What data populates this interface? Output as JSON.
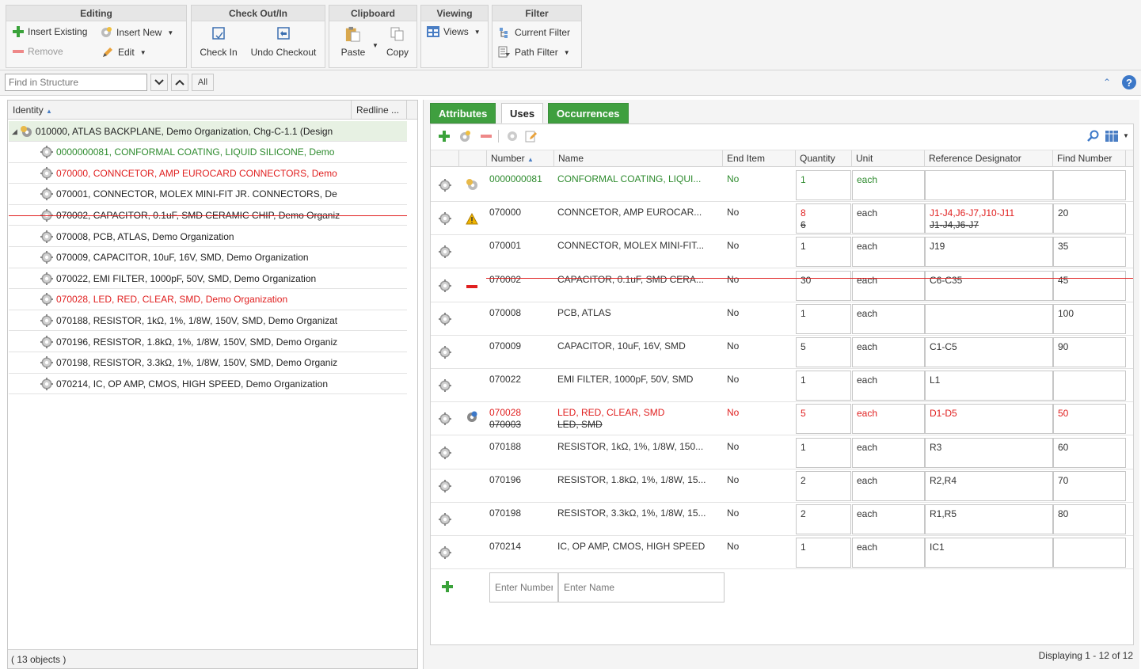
{
  "toolbar": {
    "editing": {
      "title": "Editing",
      "insert_existing": "Insert Existing",
      "insert_new": "Insert New",
      "remove": "Remove",
      "edit": "Edit"
    },
    "checkout": {
      "title": "Check Out/In",
      "check_in": "Check In",
      "undo_checkout": "Undo Checkout"
    },
    "clipboard": {
      "title": "Clipboard",
      "paste": "Paste",
      "copy": "Copy"
    },
    "viewing": {
      "title": "Viewing",
      "views": "Views"
    },
    "filter": {
      "title": "Filter",
      "current_filter": "Current Filter",
      "path_filter": "Path Filter"
    }
  },
  "find": {
    "placeholder": "Find in Structure",
    "all_label": "All"
  },
  "tree": {
    "columns": {
      "identity": "Identity",
      "redline": "Redline ..."
    },
    "rows": [
      {
        "text": "010000, ATLAS BACKPLANE, Demo Organization, Chg-C-1.1 (Design",
        "status": "normal"
      },
      {
        "text": "0000000081, CONFORMAL COATING, LIQUID SILICONE, Demo",
        "status": "added"
      },
      {
        "text": "070000, CONNCETOR,  AMP EUROCARD CONNECTORS, Demo",
        "status": "changed"
      },
      {
        "text": "070001, CONNECTOR, MOLEX MINI-FIT JR. CONNECTORS, De",
        "status": "normal"
      },
      {
        "text": "070002, CAPACITOR, 0.1uF, SMD CERAMIC CHIP, Demo Organiz",
        "status": "removed"
      },
      {
        "text": "070008, PCB, ATLAS, Demo Organization",
        "status": "normal"
      },
      {
        "text": "070009, CAPACITOR,  10uF, 16V, SMD, Demo Organization",
        "status": "normal"
      },
      {
        "text": "070022, EMI FILTER, 1000pF, 50V, SMD, Demo Organization",
        "status": "normal"
      },
      {
        "text": "070028, LED, RED, CLEAR, SMD, Demo Organization",
        "status": "changed"
      },
      {
        "text": "070188, RESISTOR, 1kΩ, 1%, 1/8W, 150V, SMD, Demo Organizat",
        "status": "normal"
      },
      {
        "text": "070196, RESISTOR, 1.8kΩ, 1%, 1/8W, 150V, SMD, Demo Organiz",
        "status": "normal"
      },
      {
        "text": "070198, RESISTOR, 3.3kΩ, 1%, 1/8W, 150V, SMD, Demo Organiz",
        "status": "normal"
      },
      {
        "text": "070214, IC, OP AMP, CMOS, HIGH SPEED, Demo Organization",
        "status": "normal"
      }
    ],
    "footer": "( 13 objects )"
  },
  "tabs": [
    {
      "label": "Attributes",
      "active": false
    },
    {
      "label": "Uses",
      "active": true
    },
    {
      "label": "Occurrences",
      "active": false
    }
  ],
  "grid": {
    "columns": {
      "number": "Number",
      "name": "Name",
      "end_item": "End Item",
      "quantity": "Quantity",
      "unit": "Unit",
      "ref_des": "Reference Designator",
      "find_number": "Find Number"
    },
    "rows": [
      {
        "status": "added",
        "number": "0000000081",
        "name": "CONFORMAL COATING, LIQUI...",
        "end_item": "No",
        "quantity": "1",
        "unit": "each",
        "ref_des": "",
        "find_number": ""
      },
      {
        "status": "changed",
        "number": "070000",
        "name": "CONNCETOR,  AMP EUROCAR...",
        "end_item": "No",
        "quantity": "8",
        "quantity_old": "6",
        "unit": "each",
        "ref_des": "J1-J4,J6-J7,J10-J11",
        "ref_des_old": "J1-J4,J6-J7",
        "find_number": "20"
      },
      {
        "status": "normal",
        "number": "070001",
        "name": "CONNECTOR, MOLEX MINI-FIT...",
        "end_item": "No",
        "quantity": "1",
        "unit": "each",
        "ref_des": "J19",
        "find_number": "35"
      },
      {
        "status": "removed",
        "number": "070002",
        "name": "CAPACITOR, 0.1uF, SMD CERA...",
        "end_item": "No",
        "quantity": "30",
        "unit": "each",
        "ref_des": "C6-C35",
        "find_number": "45"
      },
      {
        "status": "normal",
        "number": "070008",
        "name": "PCB, ATLAS",
        "end_item": "No",
        "quantity": "1",
        "unit": "each",
        "ref_des": "",
        "find_number": "100"
      },
      {
        "status": "normal",
        "number": "070009",
        "name": "CAPACITOR,  10uF, 16V, SMD",
        "end_item": "No",
        "quantity": "5",
        "unit": "each",
        "ref_des": "C1-C5",
        "find_number": "90"
      },
      {
        "status": "normal",
        "number": "070022",
        "name": "EMI FILTER, 1000pF, 50V, SMD",
        "end_item": "No",
        "quantity": "1",
        "unit": "each",
        "ref_des": "L1",
        "find_number": ""
      },
      {
        "status": "replaced",
        "number": "070028",
        "number_old": "070003",
        "name": "LED, RED, CLEAR, SMD",
        "name_old": "LED, SMD",
        "end_item": "No",
        "quantity": "5",
        "unit": "each",
        "ref_des": "D1-D5",
        "find_number": "50"
      },
      {
        "status": "normal",
        "number": "070188",
        "name": "RESISTOR, 1kΩ, 1%, 1/8W, 150...",
        "end_item": "No",
        "quantity": "1",
        "unit": "each",
        "ref_des": "R3",
        "find_number": "60"
      },
      {
        "status": "normal",
        "number": "070196",
        "name": "RESISTOR, 1.8kΩ, 1%, 1/8W, 15...",
        "end_item": "No",
        "quantity": "2",
        "unit": "each",
        "ref_des": "R2,R4",
        "find_number": "70"
      },
      {
        "status": "normal",
        "number": "070198",
        "name": "RESISTOR, 3.3kΩ, 1%, 1/8W, 15...",
        "end_item": "No",
        "quantity": "2",
        "unit": "each",
        "ref_des": "R1,R5",
        "find_number": "80"
      },
      {
        "status": "normal",
        "number": "070214",
        "name": "IC, OP AMP, CMOS, HIGH SPEED",
        "end_item": "No",
        "quantity": "1",
        "unit": "each",
        "ref_des": "IC1",
        "find_number": ""
      }
    ],
    "new_row": {
      "number_placeholder": "Enter Number",
      "name_placeholder": "Enter Name"
    },
    "status_text": "Displaying 1 - 12 of 12"
  },
  "colors": {
    "added": "#2e8b2e",
    "changed": "#e02020",
    "tab_green": "#3f9f3f"
  }
}
